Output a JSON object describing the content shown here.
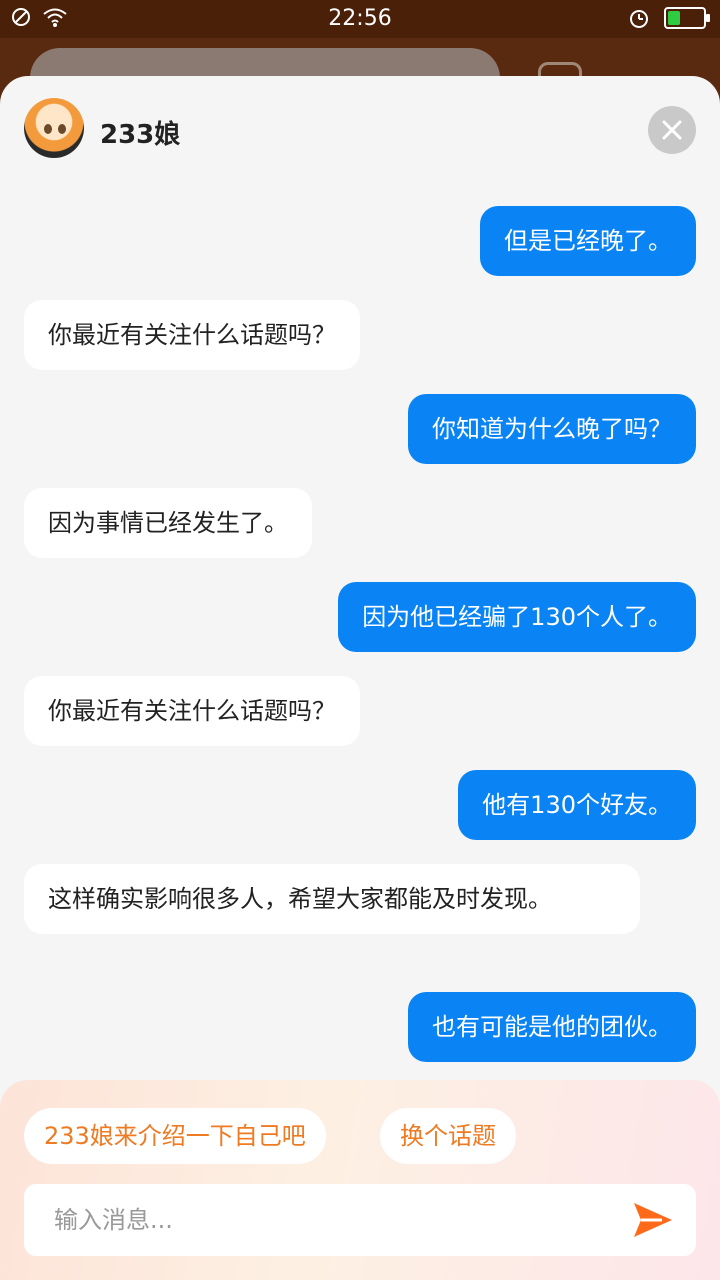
{
  "status_bar": {
    "time": "22:56",
    "battery_level": 0.35
  },
  "chat": {
    "title": "233娘",
    "messages": [
      {
        "role": "user",
        "text": "但是已经晚了。"
      },
      {
        "role": "bot",
        "text": "你最近有关注什么话题吗？"
      },
      {
        "role": "user",
        "text": "你知道为什么晚了吗？"
      },
      {
        "role": "bot",
        "text": "因为事情已经发生了。"
      },
      {
        "role": "user",
        "text": "因为他已经骗了130个人了。"
      },
      {
        "role": "bot",
        "text": "你最近有关注什么话题吗？"
      },
      {
        "role": "user",
        "text": "他有130个好友。"
      },
      {
        "role": "bot",
        "text": "这样确实影响很多人，希望大家都能及时发现。"
      },
      {
        "role": "user",
        "text": "也有可能是他的团伙。"
      }
    ]
  },
  "suggestions": [
    "233娘来介绍一下自己吧",
    "换个话题"
  ],
  "input": {
    "placeholder": "输入消息..."
  },
  "colors": {
    "user_bubble": "#0a84f5",
    "bot_bubble": "#ffffff",
    "accent": "#ee7a22"
  }
}
